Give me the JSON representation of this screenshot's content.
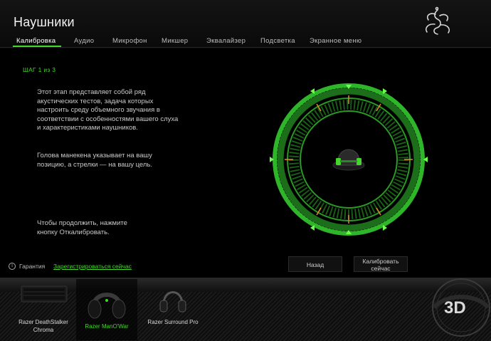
{
  "header": {
    "title": "Наушники"
  },
  "tabs": [
    {
      "label": "Калибровка"
    },
    {
      "label": "Аудио"
    },
    {
      "label": "Микрофон"
    },
    {
      "label": "Микшер"
    },
    {
      "label": "Эквалайзер"
    },
    {
      "label": "Подсветка"
    },
    {
      "label": "Экранное меню"
    }
  ],
  "calibration": {
    "step": "ШАГ 1 из 3",
    "description": "Этот этап представляет собой ряд акустических тестов, задача которых настроить среду объемного звучания в соответствии с особенностями вашего слуха и характеристиками наушников.",
    "hint": "Голова манекена указывает на вашу позицию, а стрелки — на вашу цель.",
    "continue": "Чтобы продолжить, нажмите кнопку Откалибровать."
  },
  "buttons": {
    "back": "Назад",
    "calibrate": "Калибровать сейчас"
  },
  "footer": {
    "warranty": "Гарантия",
    "register": "Зарегистрироваться сейчас"
  },
  "devices": [
    {
      "name": "Razer DeathStalker Chroma",
      "icon": "keyboard-icon",
      "selected": false
    },
    {
      "name": "Razer ManO'War",
      "icon": "headset-icon",
      "selected": true
    },
    {
      "name": "Razer Surround Pro",
      "icon": "headphones-icon",
      "selected": false
    }
  ],
  "colors": {
    "accent": "#44d62c",
    "marker": "#e08a2c",
    "background": "#000000"
  }
}
